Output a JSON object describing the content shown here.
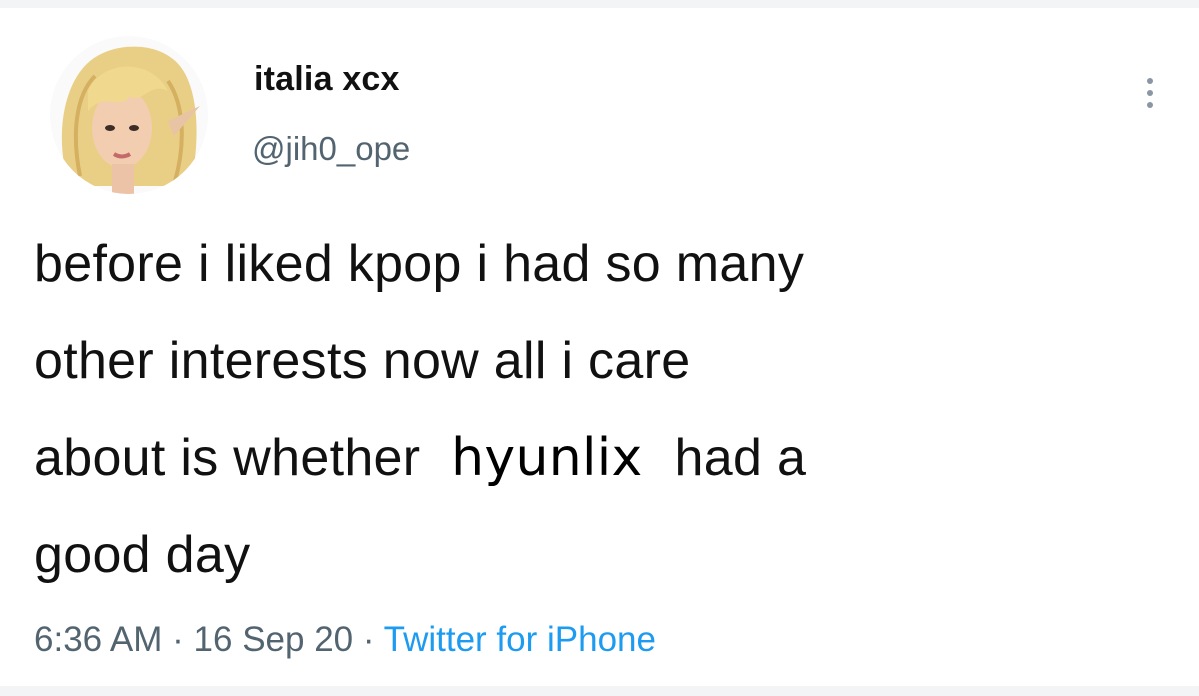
{
  "tweet": {
    "author": {
      "display_name": "italia xcx",
      "handle": "@jih0_ope",
      "avatar_icon": "profile-photo"
    },
    "more_icon": "more-vertical-icon",
    "text_lines": [
      "before i liked kpop i had so many",
      "other interests now all i care",
      "about is whether ",
      "had a",
      "good day"
    ],
    "pasted_word": "hyunlix",
    "time": "6:36 AM",
    "separator": "·",
    "date": "16 Sep 20",
    "source": "Twitter for iPhone"
  },
  "colors": {
    "text": "#111111",
    "secondary": "#536471",
    "link": "#1d9bf0",
    "background": "#ffffff"
  }
}
